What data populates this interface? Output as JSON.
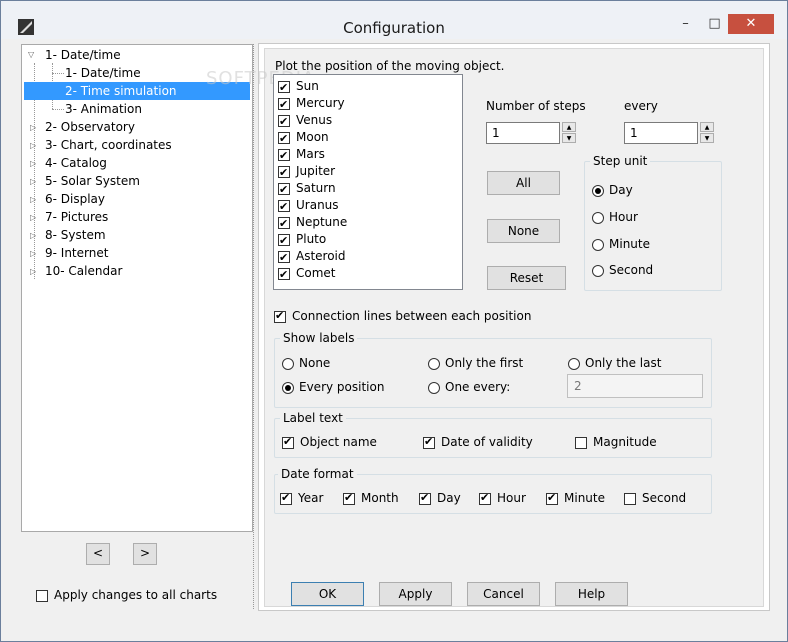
{
  "window": {
    "title": "Configuration",
    "minimize": "–",
    "maximize": "□",
    "close": "✕"
  },
  "watermark": "SOFTPEDIA",
  "tree": {
    "items": [
      {
        "label": "1- Date/time",
        "expander": "▽"
      },
      {
        "label": "1- Date/time"
      },
      {
        "label": "2- Time simulation"
      },
      {
        "label": "3- Animation"
      },
      {
        "label": "2- Observatory",
        "expander": "▷"
      },
      {
        "label": "3- Chart, coordinates",
        "expander": "▷"
      },
      {
        "label": "4- Catalog",
        "expander": "▷"
      },
      {
        "label": "5- Solar System",
        "expander": "▷"
      },
      {
        "label": "6- Display",
        "expander": "▷"
      },
      {
        "label": "7- Pictures",
        "expander": "▷"
      },
      {
        "label": "8- System",
        "expander": "▷"
      },
      {
        "label": "9- Internet",
        "expander": "▷"
      },
      {
        "label": "10- Calendar",
        "expander": "▷"
      }
    ],
    "prev": "<",
    "next": ">"
  },
  "panel": {
    "plot_label": "Plot the position of the moving object.",
    "objects": [
      "Sun",
      "Mercury",
      "Venus",
      "Moon",
      "Mars",
      "Jupiter",
      "Saturn",
      "Uranus",
      "Neptune",
      "Pluto",
      "Asteroid",
      "Comet"
    ],
    "num_steps_label": "Number of steps",
    "num_steps_value": "1",
    "every_label": "every",
    "every_value": "1",
    "btn_all": "All",
    "btn_none": "None",
    "btn_reset": "Reset",
    "step_unit": {
      "title": "Step unit",
      "options": [
        "Day",
        "Hour",
        "Minute",
        "Second"
      ],
      "selected": "Day"
    },
    "connection_lines": "Connection lines between each position",
    "show_labels": {
      "title": "Show labels",
      "none": "None",
      "only_first": "Only the first",
      "only_last": "Only the last",
      "every_position": "Every position",
      "one_every": "One every:",
      "one_every_value": "2"
    },
    "label_text": {
      "title": "Label text",
      "object_name": "Object name",
      "date_validity": "Date of validity",
      "magnitude": "Magnitude"
    },
    "date_format": {
      "title": "Date format",
      "items": [
        {
          "label": "Year",
          "checked": true
        },
        {
          "label": "Month",
          "checked": true
        },
        {
          "label": "Day",
          "checked": true
        },
        {
          "label": "Hour",
          "checked": true
        },
        {
          "label": "Minute",
          "checked": true
        },
        {
          "label": "Second",
          "checked": false
        }
      ]
    }
  },
  "footer": {
    "apply_all": "Apply changes to all charts",
    "ok": "OK",
    "apply": "Apply",
    "cancel": "Cancel",
    "help": "Help"
  }
}
